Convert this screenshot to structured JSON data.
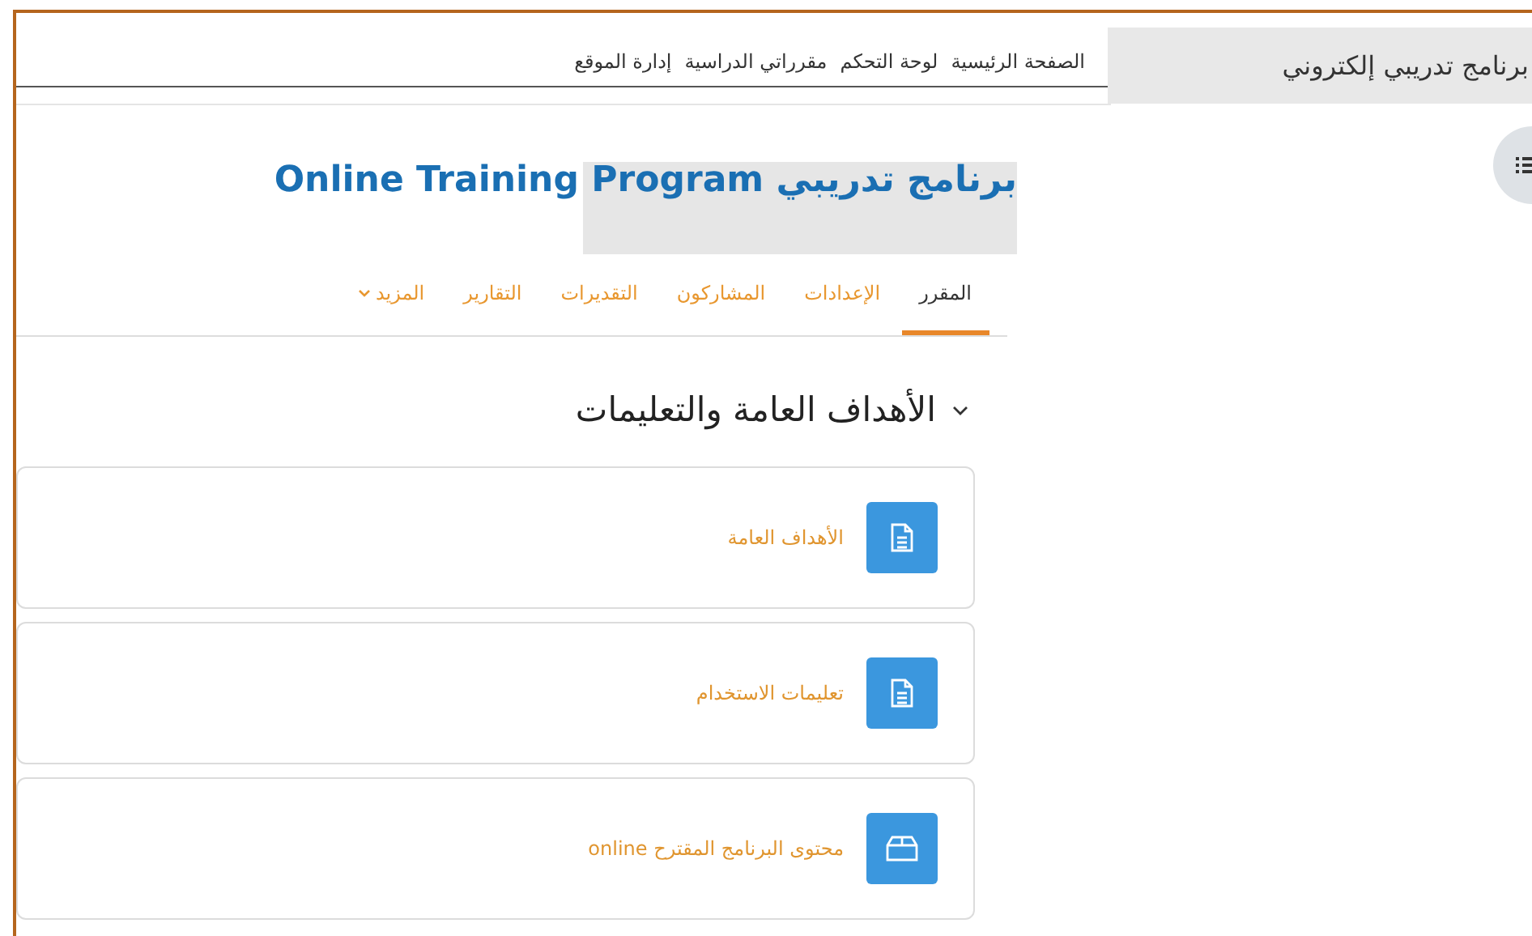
{
  "site_title": "برنامج تدريبي إلكتروني",
  "nav": [
    "الصفحة الرئيسية",
    "لوحة التحكم",
    "مقرراتي الدراسية",
    "إدارة الموقع"
  ],
  "course_title": "برنامج تدريبي  Online Training Program",
  "tabs": [
    {
      "label": "المقرر",
      "selected": true,
      "kind": "link"
    },
    {
      "label": "الإعدادات",
      "selected": false,
      "kind": "link"
    },
    {
      "label": "المشاركون",
      "selected": false,
      "kind": "link"
    },
    {
      "label": "التقديرات",
      "selected": false,
      "kind": "link"
    },
    {
      "label": "التقارير",
      "selected": false,
      "kind": "link"
    },
    {
      "label": "المزيد",
      "selected": false,
      "kind": "menu"
    }
  ],
  "section": {
    "title": "الأهداف العامة والتعليمات",
    "expanded": true
  },
  "activities": [
    {
      "kind": "page",
      "name": "الأهداف العامة"
    },
    {
      "kind": "page",
      "name": "تعليمات الاستخدام"
    },
    {
      "kind": "folder",
      "name": "محتوى البرنامج المقترح online"
    }
  ]
}
